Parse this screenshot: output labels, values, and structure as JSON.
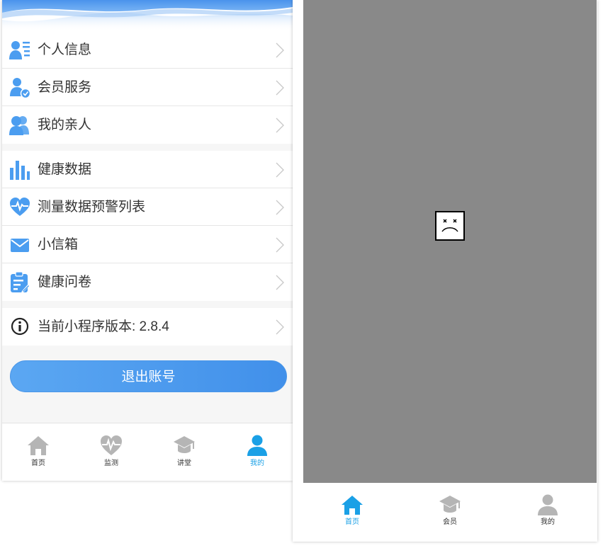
{
  "colors": {
    "accent_blue": "#4a96e8",
    "icon_blue": "#4b9df0",
    "active_tab": "#1aa0e6",
    "inactive_tab_icon": "#b5b5b5",
    "placeholder_gray": "#898989"
  },
  "left_phone": {
    "menu_groups": [
      {
        "items": [
          {
            "label": "个人信息",
            "icon": "id-card-icon"
          },
          {
            "label": "会员服务",
            "icon": "member-icon"
          },
          {
            "label": "我的亲人",
            "icon": "family-icon"
          }
        ]
      },
      {
        "items": [
          {
            "label": "健康数据",
            "icon": "bar-chart-icon"
          },
          {
            "label": "测量数据预警列表",
            "icon": "heart-pulse-icon"
          },
          {
            "label": "小信箱",
            "icon": "mail-icon"
          },
          {
            "label": "健康问卷",
            "icon": "clipboard-icon"
          }
        ]
      },
      {
        "items": [
          {
            "label": "当前小程序版本: 2.8.4",
            "icon": "info-icon"
          }
        ]
      }
    ],
    "logout_label": "退出账号",
    "tabs": [
      {
        "label": "首页",
        "icon": "home-icon",
        "active": false
      },
      {
        "label": "监测",
        "icon": "heart-monitor-icon",
        "active": false
      },
      {
        "label": "讲堂",
        "icon": "graduation-cap-icon",
        "active": false
      },
      {
        "label": "我的",
        "icon": "user-icon",
        "active": true
      }
    ]
  },
  "right_phone": {
    "content_state": "broken-image-icon",
    "tabs": [
      {
        "label": "首页",
        "icon": "home-icon",
        "active": true
      },
      {
        "label": "会员",
        "icon": "graduation-cap-icon",
        "active": false
      },
      {
        "label": "我的",
        "icon": "user-icon",
        "active": false
      }
    ]
  }
}
